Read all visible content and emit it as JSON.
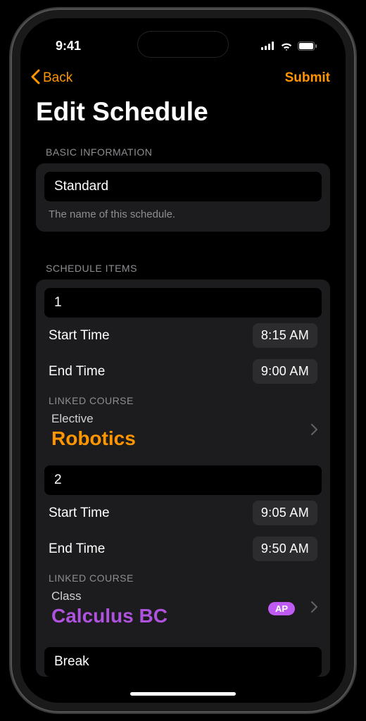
{
  "status": {
    "time": "9:41"
  },
  "nav": {
    "back_label": "Back",
    "submit_label": "Submit"
  },
  "title": "Edit Schedule",
  "basic_info": {
    "header": "BASIC INFORMATION",
    "name_value": "Standard",
    "helper": "The name of this schedule."
  },
  "schedule_items": {
    "header": "SCHEDULE ITEMS",
    "items": [
      {
        "index": "1",
        "start_label": "Start Time",
        "start_value": "8:15 AM",
        "end_label": "End Time",
        "end_value": "9:00 AM",
        "linked_header": "LINKED COURSE",
        "course_type": "Elective",
        "course_name": "Robotics",
        "badge": null
      },
      {
        "index": "2",
        "start_label": "Start Time",
        "start_value": "9:05 AM",
        "end_label": "End Time",
        "end_value": "9:50 AM",
        "linked_header": "LINKED COURSE",
        "course_type": "Class",
        "course_name": "Calculus BC",
        "badge": "AP"
      }
    ],
    "break_label": "Break"
  }
}
